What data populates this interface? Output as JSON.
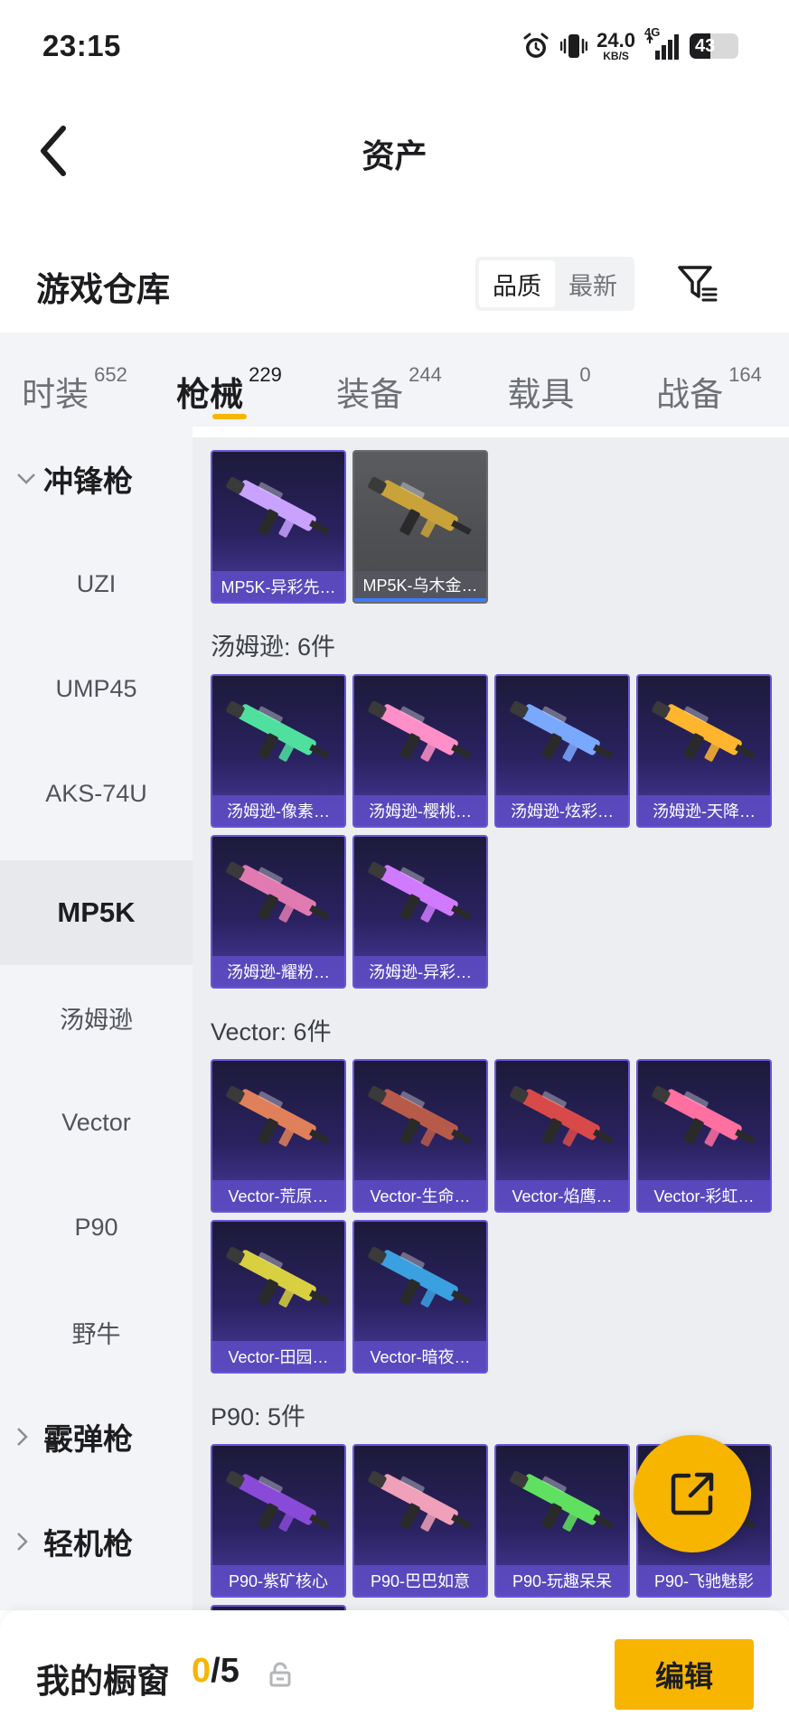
{
  "status_bar": {
    "time": "23:15",
    "net_speed_value": "24.0",
    "net_speed_unit": "KB/S",
    "net_type": "4G",
    "battery": "43",
    "battery_level": 0.43
  },
  "header": {
    "title": "资产"
  },
  "warehouse": {
    "title": "游戏仓库",
    "sort_options": [
      "品质",
      "最新"
    ],
    "active_sort": 0
  },
  "tabs": [
    {
      "label": "时装",
      "count": "652"
    },
    {
      "label": "枪械",
      "count": "229",
      "active": true
    },
    {
      "label": "装备",
      "count": "244"
    },
    {
      "label": "载具",
      "count": "0"
    },
    {
      "label": "战备",
      "count": "164"
    }
  ],
  "sidebar": {
    "cat_smg": "冲锋枪",
    "uzi": "UZI",
    "ump45": "UMP45",
    "aks74u": "AKS-74U",
    "mp5k": "MP5K",
    "tommy": "汤姆逊",
    "vector": "Vector",
    "p90": "P90",
    "bizon": "野牛",
    "cat_shotgun": "霰弹枪",
    "cat_lmg": "轻机枪"
  },
  "groups": {
    "mp5k": {
      "items": [
        {
          "label": "MP5K-异彩先…",
          "color": "#c9a2ff"
        },
        {
          "label": "MP5K-乌木金…",
          "color": "#c9a23a"
        }
      ]
    },
    "tommy": {
      "title": "汤姆逊: 6件",
      "items": [
        {
          "label": "汤姆逊-像素…",
          "color": "#4fe0a0"
        },
        {
          "label": "汤姆逊-樱桃…",
          "color": "#ff8fc8"
        },
        {
          "label": "汤姆逊-炫彩…",
          "color": "#7aa8ff"
        },
        {
          "label": "汤姆逊-天降…",
          "color": "#ffb52e"
        },
        {
          "label": "汤姆逊-耀粉…",
          "color": "#e07ab0"
        },
        {
          "label": "汤姆逊-异彩…",
          "color": "#d07aff"
        }
      ]
    },
    "vector": {
      "title": "Vector: 6件",
      "items": [
        {
          "label": "Vector-荒原…",
          "color": "#e0805a"
        },
        {
          "label": "Vector-生命…",
          "color": "#b85a4a"
        },
        {
          "label": "Vector-焰鹰…",
          "color": "#d84a4a"
        },
        {
          "label": "Vector-彩虹…",
          "color": "#ff6fa0"
        },
        {
          "label": "Vector-田园…",
          "color": "#d8d040"
        },
        {
          "label": "Vector-暗夜…",
          "color": "#3aa0e0"
        }
      ]
    },
    "p90": {
      "title": "P90: 5件",
      "items": [
        {
          "label": "P90-紫矿核心",
          "color": "#8a4ad8"
        },
        {
          "label": "P90-巴巴如意",
          "color": "#f0a0b8"
        },
        {
          "label": "P90-玩趣呆呆",
          "color": "#60e060"
        },
        {
          "label": "P90-飞驰魅影",
          "color": "#e0e0e0"
        }
      ]
    }
  },
  "bottom": {
    "title": "我的橱窗",
    "count_current": "0",
    "count_sep_total": "/5",
    "edit_label": "编辑"
  },
  "colors": {
    "accent": "#f7b500",
    "card_border": "#6a55d8"
  }
}
